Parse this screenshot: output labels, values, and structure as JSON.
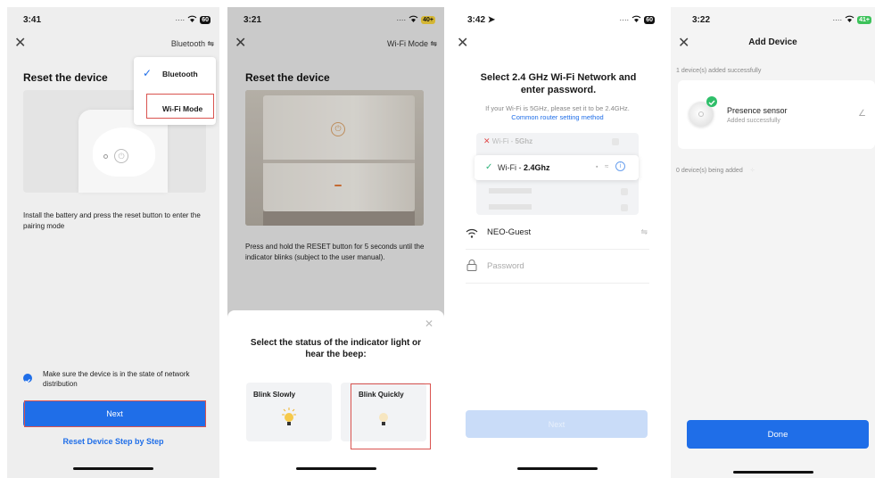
{
  "s1": {
    "time": "3:41",
    "mode_toggle": "Bluetooth ⇋",
    "title": "Reset the device",
    "menu": [
      "Bluetooth",
      "Wi-Fi Mode"
    ],
    "instruction": "Install the battery and press the reset button to enter the pairing mode",
    "confirm": "Make sure the device is in the state of network distribution",
    "next": "Next",
    "reset_link": "Reset Device Step by Step",
    "colors": {
      "accent": "#1f6ee8",
      "highlight": "#d9534f"
    }
  },
  "s2": {
    "time": "3:21",
    "battery": "40+",
    "mode_toggle": "Wi-Fi Mode ⇋",
    "title": "Reset the device",
    "instruction": "Press and hold the RESET button for 5 seconds until the indicator blinks (subject to the user manual).",
    "sheet_title": "Select the status of the indicator light or hear the beep:",
    "options": [
      "Blink Slowly",
      "Blink Quickly"
    ]
  },
  "s3": {
    "time": "3:42",
    "title": "Select 2.4 GHz Wi-Fi Network and enter password.",
    "hint": "If your Wi-Fi is 5GHz, please set it to be 2.4GHz.",
    "hint_link": "Common router setting method",
    "net_bad_prefix": "Wi-Fi - ",
    "net_bad_band": "5Ghz",
    "net_good_prefix": "Wi-Fi - ",
    "net_good_band": "2.4Ghz",
    "ssid": "NEO-Guest",
    "password_placeholder": "Password",
    "next": "Next"
  },
  "s4": {
    "time": "3:22",
    "battery": "41+",
    "title": "Add Device",
    "added_count": "1 device(s) added successfully",
    "device_name": "Presence sensor",
    "device_status": "Added successfully",
    "adding_count": "0 device(s) being added",
    "done": "Done"
  }
}
